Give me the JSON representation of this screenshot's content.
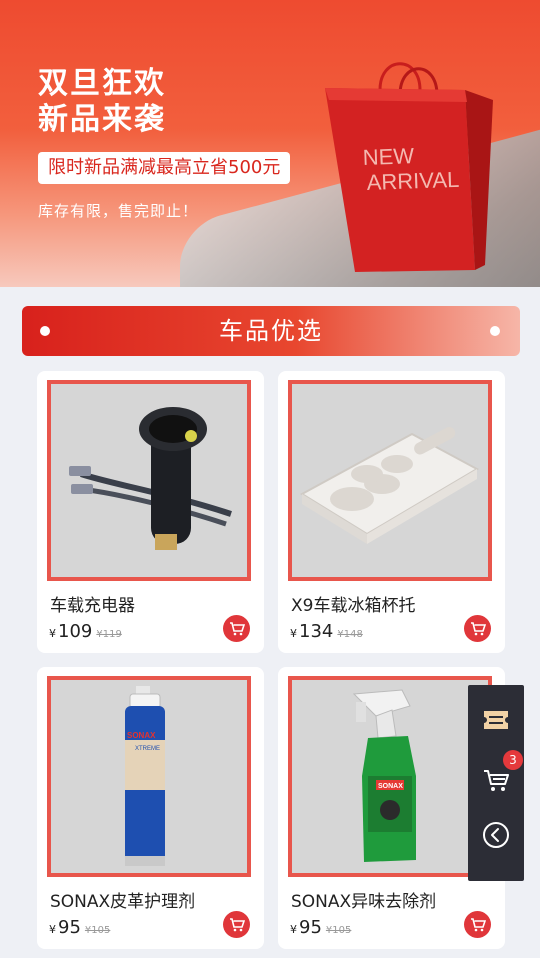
{
  "banner": {
    "title_line1": "双旦狂欢",
    "title_line2": "新品来袭",
    "promo": "限时新品满减最高立省500元",
    "note": "库存有限，售完即止！",
    "bag_text_1": "NEW",
    "bag_text_2": "ARRIVAL"
  },
  "section": {
    "title": "车品优选"
  },
  "currency": "¥",
  "products": [
    {
      "name": "车载充电器",
      "price": "109",
      "old_price": "¥119",
      "image": "car-charger"
    },
    {
      "name": "X9车载冰箱杯托",
      "price": "134",
      "old_price": "¥148",
      "image": "cup-holder-tray"
    },
    {
      "name": "SONAX皮革护理剂",
      "price": "95",
      "old_price": "¥105",
      "image": "sonax-spray-can",
      "image_text": "SONAX",
      "image_subtext": "XTREME"
    },
    {
      "name": "SONAX异味去除剂",
      "price": "95",
      "old_price": "¥105",
      "image": "sonax-spray-bottle",
      "image_text": "SONAX"
    }
  ],
  "sidebar": {
    "cart_count": "3",
    "items": [
      "coupon-icon",
      "cart-icon",
      "back-icon"
    ]
  },
  "colors": {
    "accent": "#e0363a",
    "card_border": "#e8564c",
    "sidebar_bg": "#2c2d36"
  }
}
